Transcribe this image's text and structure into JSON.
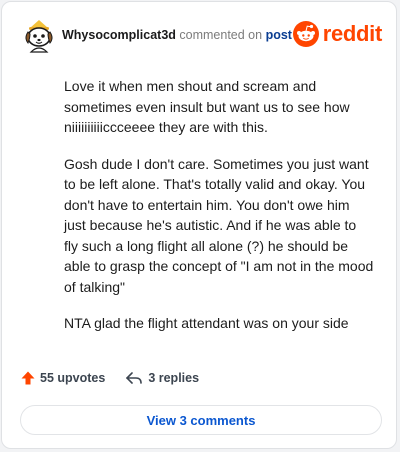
{
  "header": {
    "username": "Whysocomplicat3d",
    "commented_text": "commented on",
    "post_link": "post",
    "logo_text": "reddit"
  },
  "comment": {
    "paragraphs": [
      "Love it when men shout and scream and sometimes even insult but want us to see how niiiiiiiiiiccceeee they are with this.",
      "Gosh dude I don't care. Sometimes you just want to be left alone. That's totally valid and okay. You don't have to entertain him. You don't owe him just because he's autistic. And if he was able to fly such a long flight all alone (?) he should be able to grasp the concept of \"I am not in the mood of talking\"",
      "NTA glad the flight attendant was on your side"
    ]
  },
  "footer": {
    "upvotes": "55 upvotes",
    "replies": "3 replies",
    "view_comments": "View 3 comments"
  },
  "icons": {
    "avatar": "snoo-avatar-icon",
    "logo": "reddit-alien-icon",
    "upvote": "upvote-arrow-icon",
    "reply": "reply-arrow-icon"
  },
  "colors": {
    "brand": "#ff4500",
    "link": "#0b57d0",
    "text": "#1c1c1c"
  }
}
